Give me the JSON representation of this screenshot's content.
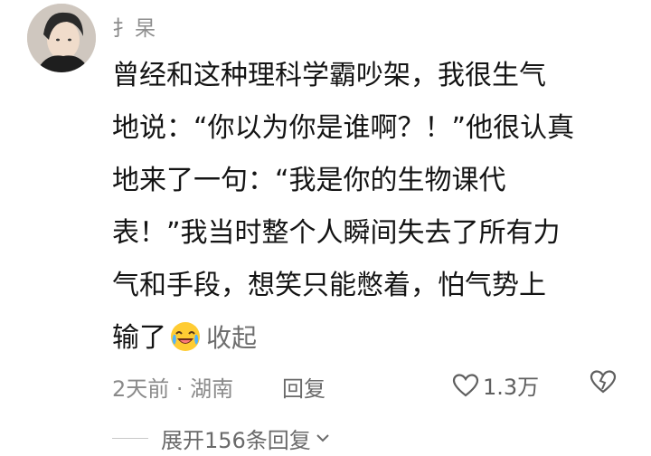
{
  "comment": {
    "username": "扌杲",
    "text_lines": [
      "曾经和这种理科学霸吵架，我很生气",
      "地说：“你以为你是谁啊？！”他很认真",
      "地来了一句：“我是你的生物课代",
      "表！”我当时整个人瞬间失去了所有力",
      "气和手段，想笑只能憋着，怕气势上",
      "输了"
    ],
    "emoji": "laughing-crying-emoji",
    "collapse_label": "收起",
    "time_location": "2天前 · 湖南",
    "reply_label": "回复",
    "like_count": "1.3万",
    "expand_replies_label": "展开156条回复"
  },
  "colors": {
    "text": "#141414",
    "secondary": "#8a8a8a",
    "emoji_yellow": "#ffcc33"
  }
}
